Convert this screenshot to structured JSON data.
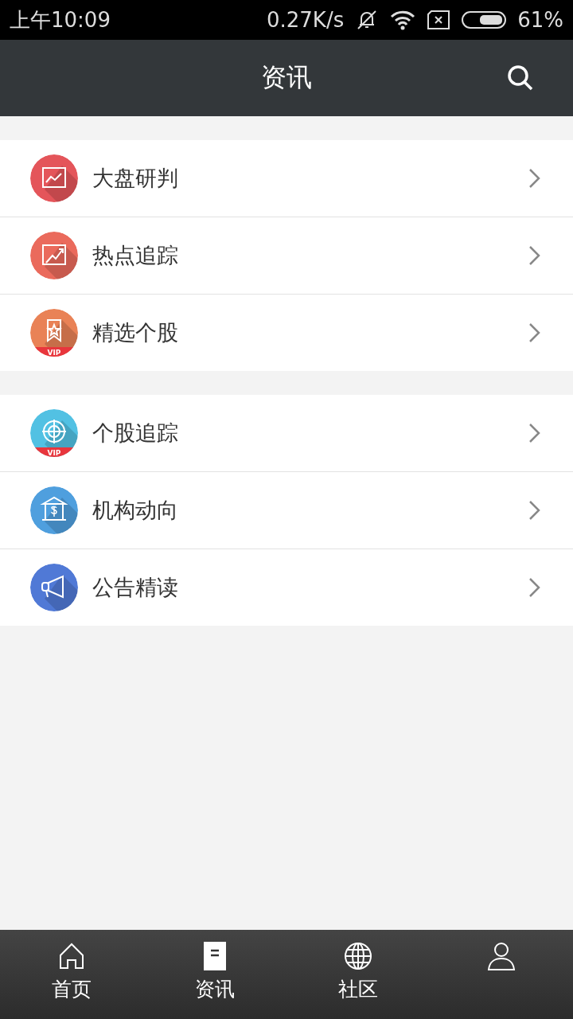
{
  "status_bar": {
    "time": "上午10:09",
    "speed": "0.27K/s",
    "battery": "61%"
  },
  "header": {
    "title": "资讯"
  },
  "groups": [
    {
      "items": [
        {
          "label": "大盘研判",
          "kind": "chart",
          "color": "#e4555a"
        },
        {
          "label": "热点追踪",
          "kind": "trend",
          "color": "#ea6a5c"
        },
        {
          "label": "精选个股",
          "kind": "bookmark",
          "color": "#e98256",
          "badge": "VIP"
        }
      ]
    },
    {
      "items": [
        {
          "label": "个股追踪",
          "kind": "target",
          "color": "#52c1e3",
          "badge": "VIP"
        },
        {
          "label": "机构动向",
          "kind": "bank",
          "color": "#4f9fde"
        },
        {
          "label": "公告精读",
          "kind": "megaphone",
          "color": "#5079d6"
        }
      ]
    }
  ],
  "tab_bar": [
    {
      "label": "首页",
      "kind": "home",
      "selected": false
    },
    {
      "label": "资讯",
      "kind": "doc",
      "selected": true
    },
    {
      "label": "社区",
      "kind": "globe",
      "selected": false
    },
    {
      "kind": "person",
      "selected": false
    }
  ]
}
